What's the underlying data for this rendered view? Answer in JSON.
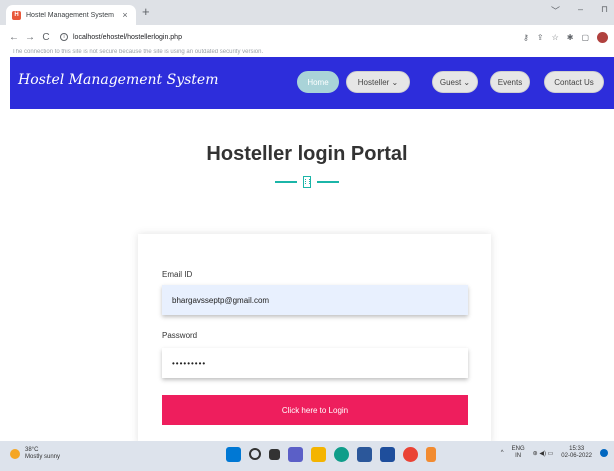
{
  "browser": {
    "tab_title": "Hostel Management System",
    "tab_close": "×",
    "new_tab": "+",
    "win_min": "﹀",
    "win_minimize": "–",
    "win_restore": "⊓",
    "back": "←",
    "forward": "→",
    "reload": "C",
    "url": "localhost/ehostel/hostellerlogin.php",
    "warning": "The connection to this site is not secure because the site is using an outdated security version."
  },
  "site": {
    "brand": "Hostel Management System",
    "nav": [
      {
        "label": "Home",
        "active": true
      },
      {
        "label": "Hosteller ⌄",
        "active": false
      },
      {
        "label": "Guest ⌄",
        "active": false
      },
      {
        "label": "Events",
        "active": false
      },
      {
        "label": "Contact Us",
        "active": false
      }
    ],
    "accent_color": "#2d2ddb"
  },
  "login": {
    "title": "Hosteller login Portal",
    "email_label": "Email ID",
    "email_value": "bhargavsseptp@gmail.com",
    "password_label": "Password",
    "password_value": "•••••••••",
    "button_label": "Click here to Login",
    "button_color": "#ee1e5d"
  },
  "taskbar": {
    "temp": "38°C",
    "weather": "Mostly sunny",
    "lang_1": "ENG",
    "lang_2": "IN",
    "time": "15:33",
    "date": "02-06-2022",
    "chevron": "^"
  }
}
